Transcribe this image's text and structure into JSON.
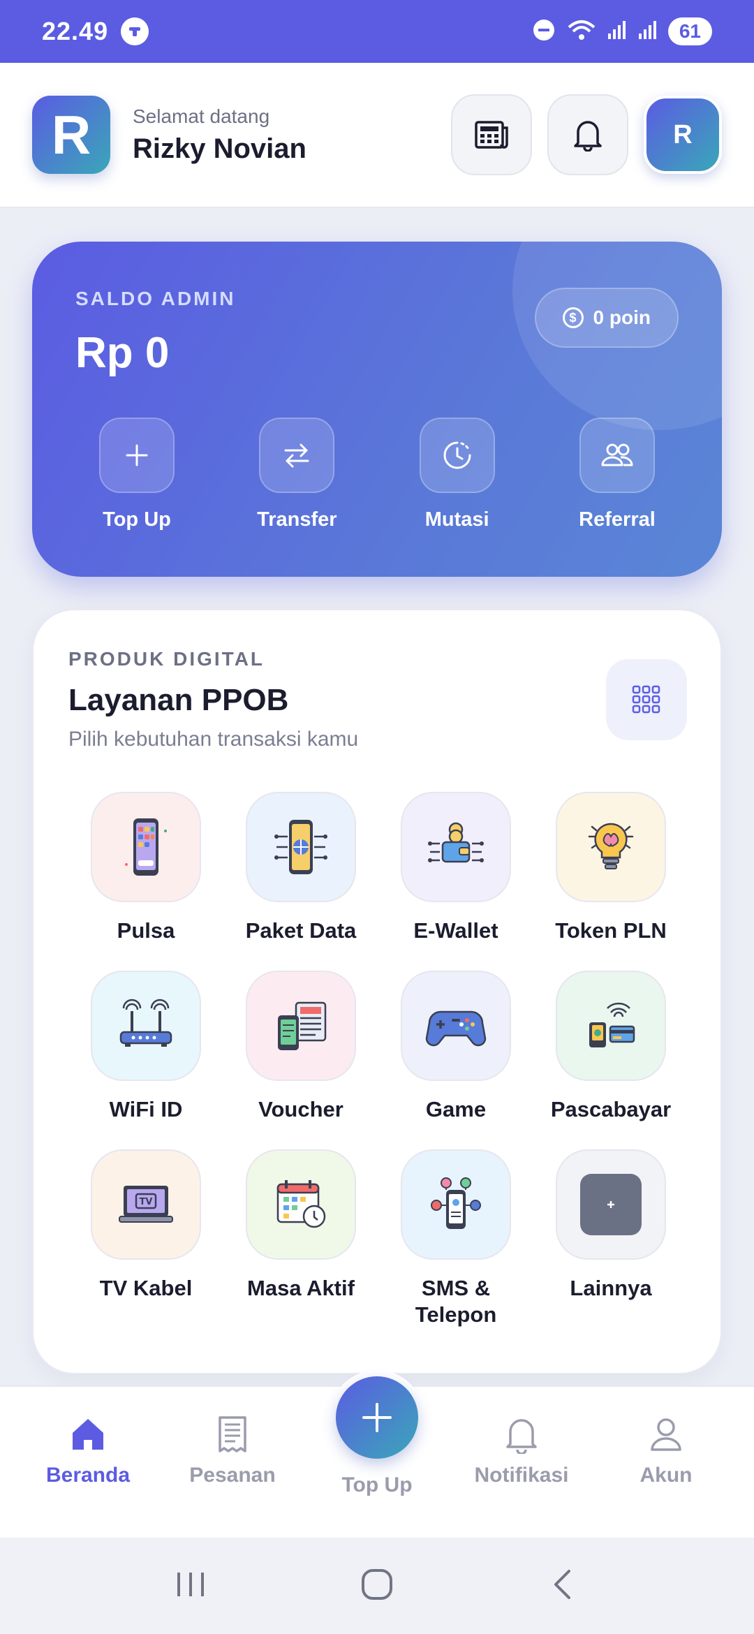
{
  "status_bar": {
    "time": "22.49",
    "battery": "61"
  },
  "header": {
    "logo_letter": "R",
    "greeting": "Selamat datang",
    "user_name": "Rizky Novian",
    "avatar_letter": "R"
  },
  "balance": {
    "label": "SALDO ADMIN",
    "value": "Rp 0",
    "points": "0 poin",
    "actions": [
      {
        "label": "Top Up",
        "icon": "plus-icon"
      },
      {
        "label": "Transfer",
        "icon": "transfer-arrows-icon"
      },
      {
        "label": "Mutasi",
        "icon": "history-clock-icon"
      },
      {
        "label": "Referral",
        "icon": "people-icon"
      }
    ]
  },
  "products": {
    "kicker": "PRODUK DIGITAL",
    "title": "Layanan PPOB",
    "subtitle": "Pilih kebutuhan transaksi kamu",
    "items": [
      {
        "label": "Pulsa",
        "icon": "phone-apps-icon",
        "bg": "#fdeeee"
      },
      {
        "label": "Paket Data",
        "icon": "phone-globe-icon",
        "bg": "#eaf2fd"
      },
      {
        "label": "E-Wallet",
        "icon": "wallet-coins-icon",
        "bg": "#f1effc"
      },
      {
        "label": "Token PLN",
        "icon": "lightbulb-icon",
        "bg": "#fdf5e4"
      },
      {
        "label": "WiFi ID",
        "icon": "router-icon",
        "bg": "#e8f7fc"
      },
      {
        "label": "Voucher",
        "icon": "voucher-newspaper-icon",
        "bg": "#fcecf2"
      },
      {
        "label": "Game",
        "icon": "gamepad-icon",
        "bg": "#eef0fc"
      },
      {
        "label": "Pascabayar",
        "icon": "card-payment-icon",
        "bg": "#e9f7ef"
      },
      {
        "label": "TV Kabel",
        "icon": "tv-icon",
        "bg": "#fdf2e8"
      },
      {
        "label": "Masa Aktif",
        "icon": "calendar-clock-icon",
        "bg": "#f0f9e8"
      },
      {
        "label": "SMS & Telepon",
        "icon": "phone-chat-icon",
        "bg": "#e8f4fd"
      },
      {
        "label": "Lainnya",
        "icon": "more-plus-icon",
        "bg": "#f2f3f6"
      }
    ]
  },
  "bottom_nav": {
    "items": [
      {
        "label": "Beranda",
        "icon": "home-icon"
      },
      {
        "label": "Pesanan",
        "icon": "receipt-icon"
      },
      {
        "label": "Notifikasi",
        "icon": "bell-icon"
      },
      {
        "label": "Akun",
        "icon": "user-icon"
      }
    ],
    "fab_label": "Top Up"
  },
  "colors": {
    "accent": "#5b5ce2",
    "teal": "#3aa7b8"
  }
}
